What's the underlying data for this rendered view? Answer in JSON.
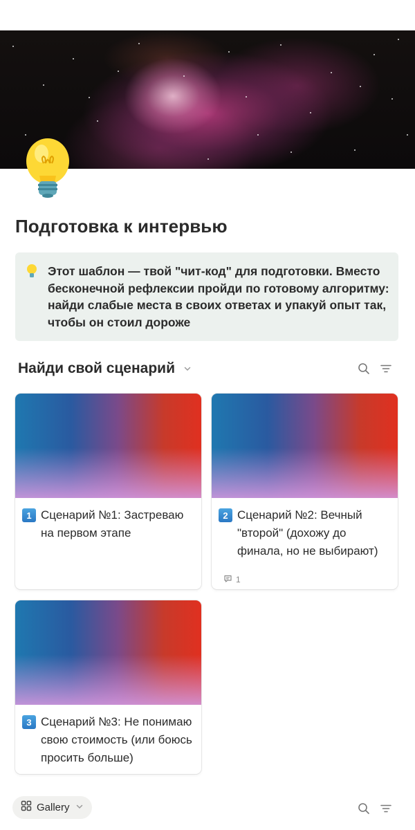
{
  "page": {
    "title": "Подготовка к интервью",
    "icon": "lightbulb-icon"
  },
  "callout": {
    "icon": "lightbulb-icon",
    "text": "Этот шаблон — твой \"чит-код\" для подготовки. Вместо бесконечной рефлексии пройди по готовому алгоритму: найди слабые места в своих ответах и упакуй опыт так, чтобы он стоил дороже"
  },
  "view": {
    "title": "Найди свой сценарий",
    "dropdown_icon": "chevron-down-icon",
    "search_icon": "search-icon",
    "filter_icon": "filter-icon"
  },
  "cards": [
    {
      "emoji": "1",
      "title": "Сценарий №1: Застреваю на первом этапе"
    },
    {
      "emoji": "2",
      "title": "Сценарий №2: Вечный \"второй\" (дохожу до финала, но не выбирают)",
      "comments": "1"
    },
    {
      "emoji": "3",
      "title": "Сценарий №3: Не понимаю свою стоимость (или боюсь просить больше)"
    }
  ],
  "bottom_bar": {
    "layout_label": "Gallery",
    "layout_icon": "gallery-grid-icon"
  },
  "colors": {
    "text": "#2b2b2b",
    "callout_bg": "#ecf1ee",
    "muted": "#8a8a8a"
  }
}
